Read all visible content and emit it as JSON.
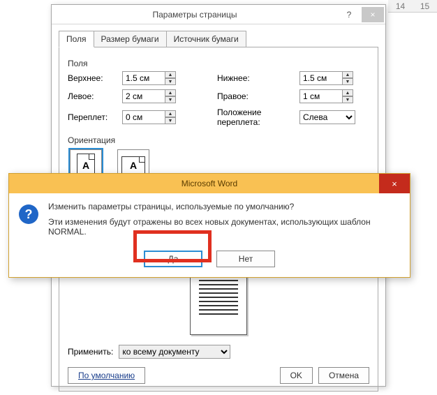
{
  "ruler": {
    "mark1": "14",
    "mark2": "15"
  },
  "dialog": {
    "title": "Параметры страницы",
    "help": "?",
    "close": "×",
    "tabs": {
      "t0": "Поля",
      "t1": "Размер бумаги",
      "t2": "Источник бумаги"
    },
    "group_fields": "Поля",
    "labels": {
      "top": "Верхнее:",
      "bottom": "Нижнее:",
      "left": "Левое:",
      "right": "Правое:",
      "gutter": "Переплет:",
      "gutter_pos": "Положение переплета:"
    },
    "values": {
      "top": "1.5 см",
      "bottom": "1.5 см",
      "left": "2 см",
      "right": "1 см",
      "gutter": "0 см",
      "gutter_pos": "Слева"
    },
    "group_orientation": "Ориентация",
    "orient": {
      "portrait": "книжная",
      "landscape": "альбомная",
      "glyph": "A"
    },
    "apply_label": "Применить:",
    "apply_value": "ко всему документу",
    "buttons": {
      "default": "По умолчанию",
      "ok": "OK",
      "cancel": "Отмена"
    }
  },
  "msgbox": {
    "title": "Microsoft Word",
    "close": "×",
    "icon": "?",
    "line1": "Изменить параметры страницы, используемые по умолчанию?",
    "line2": "Эти изменения будут отражены во всех новых документах, использующих шаблон NORMAL.",
    "yes": "Да",
    "no": "Нет"
  }
}
